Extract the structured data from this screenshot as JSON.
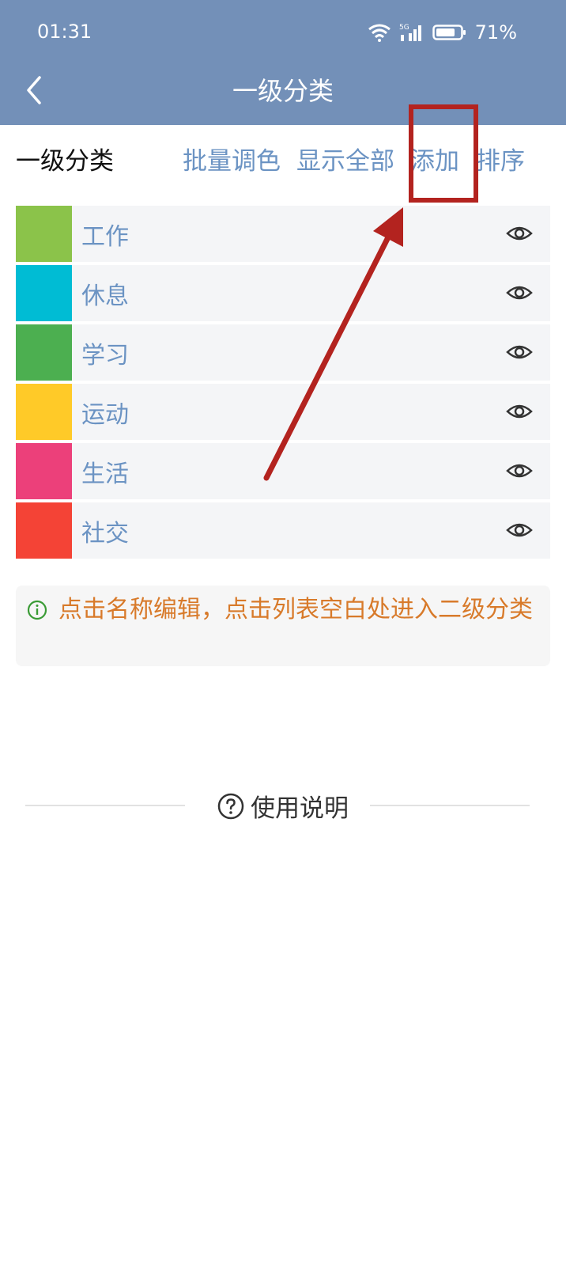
{
  "status_bar": {
    "time": "01:31",
    "network": "5G",
    "battery": "71%"
  },
  "header": {
    "title": "一级分类"
  },
  "toolbar": {
    "label": "一级分类",
    "batch_color": "批量调色",
    "show_all": "显示全部",
    "add": "添加",
    "sort": "排序"
  },
  "categories": [
    {
      "label": "工作",
      "color": "#8bc34a"
    },
    {
      "label": "休息",
      "color": "#00bcd4"
    },
    {
      "label": "学习",
      "color": "#4caf50"
    },
    {
      "label": "运动",
      "color": "#ffca28"
    },
    {
      "label": "生活",
      "color": "#ec407a"
    },
    {
      "label": "社交",
      "color": "#f44336"
    }
  ],
  "tip": {
    "text": "点击名称编辑，点击列表空白处进入二级分类"
  },
  "help": {
    "label": "使用说明"
  },
  "colors": {
    "header_bg": "#7390b8",
    "link": "#6b93c3",
    "tip_text": "#d87a2a",
    "tip_icon": "#3a9b35",
    "annotation": "#b3231f"
  },
  "icons": [
    "back-arrow-icon",
    "wifi-icon",
    "signal-icon",
    "battery-icon",
    "eye-icon",
    "info-icon",
    "help-circle-icon"
  ]
}
